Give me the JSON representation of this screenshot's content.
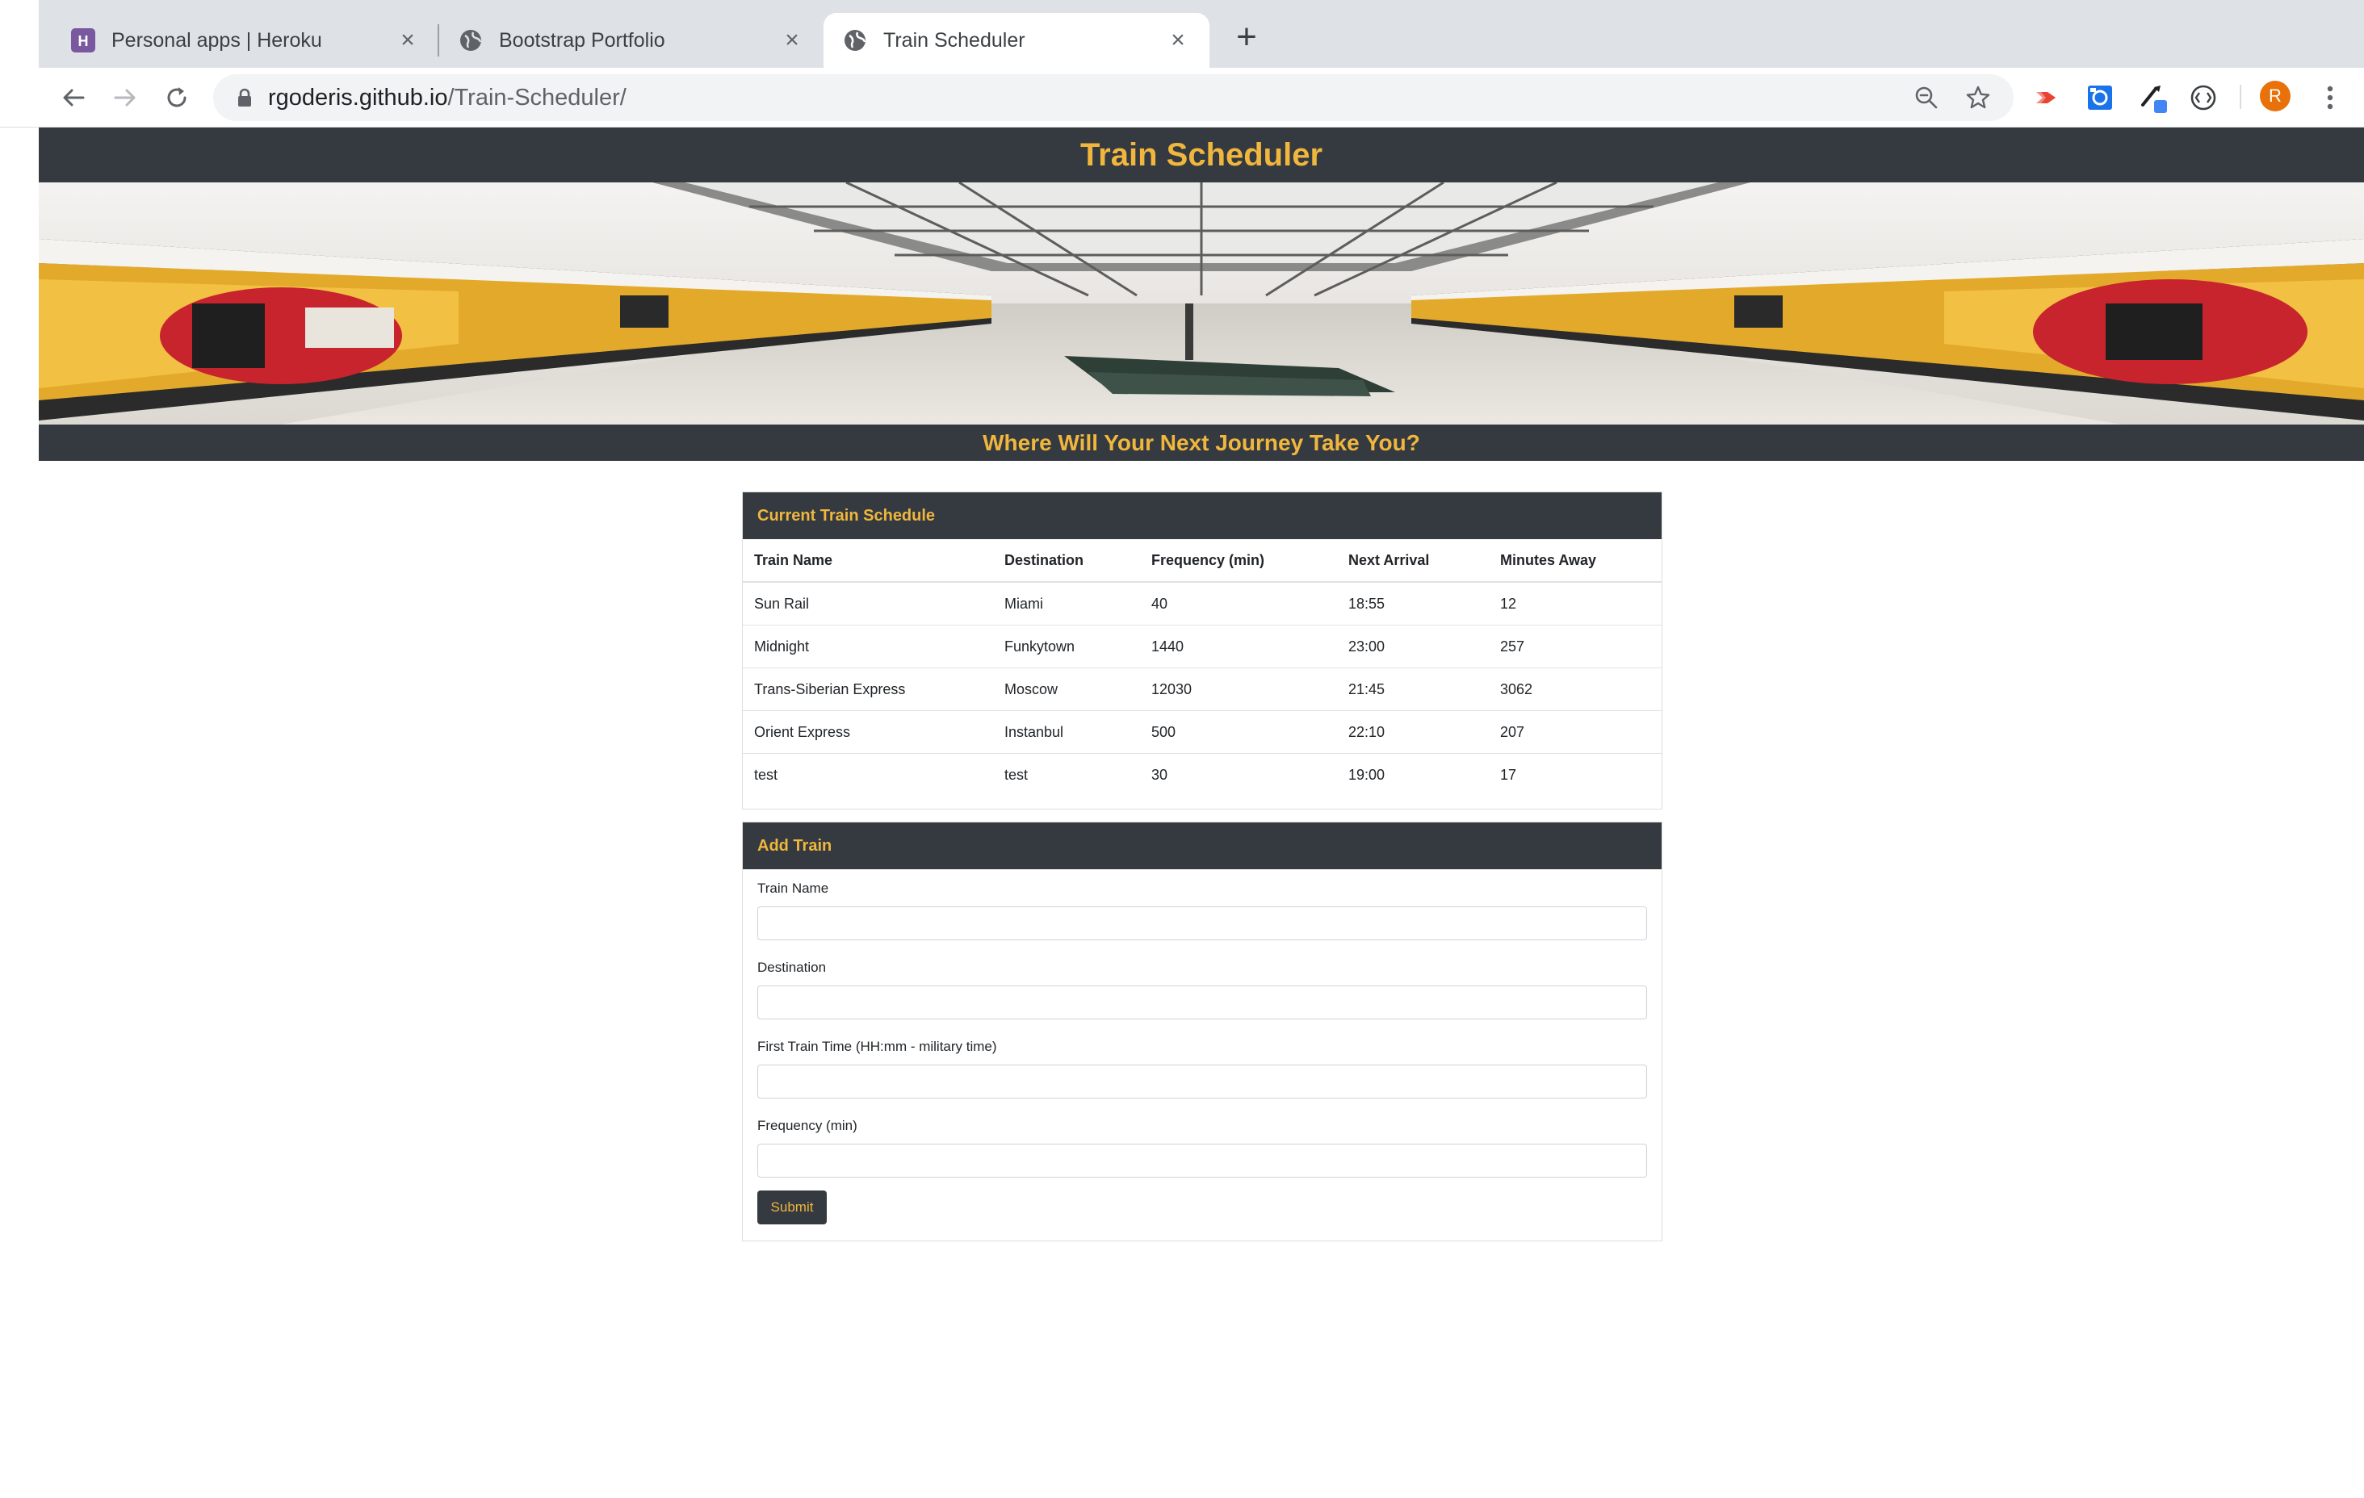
{
  "browser": {
    "tabs": [
      {
        "title": "Personal apps | Heroku",
        "icon": "heroku-icon",
        "active": false
      },
      {
        "title": "Bootstrap Portfolio",
        "icon": "globe-icon",
        "active": false
      },
      {
        "title": "Train Scheduler",
        "icon": "globe-icon",
        "active": true
      }
    ],
    "url_host": "rgoderis.github.io",
    "url_path": "/Train-Scheduler/",
    "profile_initial": "R",
    "colors": {
      "tabstrip": "#dee1e6",
      "profile": "#e8710a"
    }
  },
  "site": {
    "title": "Train Scheduler",
    "tagline": "Where Will Your Next Journey Take You?",
    "colors": {
      "dark": "#343a40",
      "accent": "#f0b63d"
    }
  },
  "schedule": {
    "heading": "Current Train Schedule",
    "columns": [
      "Train Name",
      "Destination",
      "Frequency (min)",
      "Next Arrival",
      "Minutes Away"
    ],
    "rows": [
      [
        "Sun Rail",
        "Miami",
        "40",
        "18:55",
        "12"
      ],
      [
        "Midnight",
        "Funkytown",
        "1440",
        "23:00",
        "257"
      ],
      [
        "Trans-Siberian Express",
        "Moscow",
        "12030",
        "21:45",
        "3062"
      ],
      [
        "Orient Express",
        "Instanbul",
        "500",
        "22:10",
        "207"
      ],
      [
        "test",
        "test",
        "30",
        "19:00",
        "17"
      ]
    ]
  },
  "add_train": {
    "heading": "Add Train",
    "fields": [
      {
        "label": "Train Name",
        "value": ""
      },
      {
        "label": "Destination",
        "value": ""
      },
      {
        "label": "First Train Time (HH:mm - military time)",
        "value": ""
      },
      {
        "label": "Frequency (min)",
        "value": ""
      }
    ],
    "submit_label": "Submit"
  }
}
